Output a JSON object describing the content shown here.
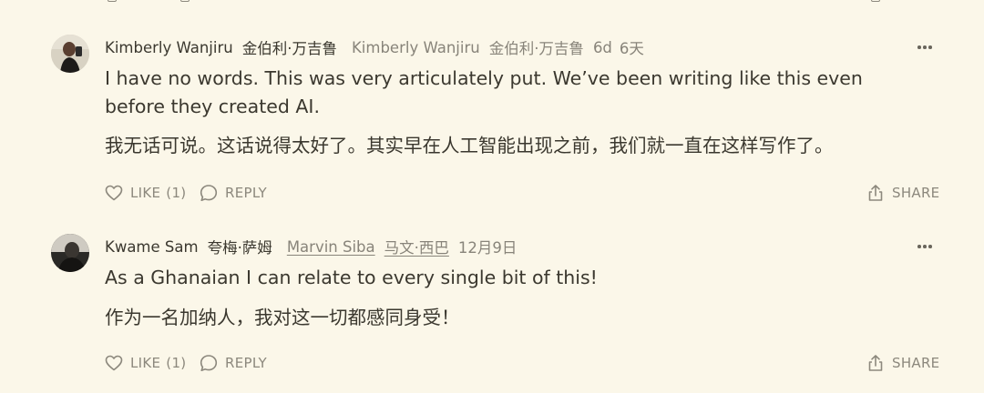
{
  "comments": [
    {
      "author": "Kimberly Wanjiru",
      "author_zh": "金伯利·万吉鲁",
      "reply_to": "Kimberly Wanjiru",
      "reply_to_zh": "金伯利·万吉鲁",
      "time": "6d",
      "time_zh": "6天",
      "text": "I have no words. This was very articulately put. We’ve been writing like this even before they created AI.",
      "text_zh": "我无话可说。这话说得太好了。其实早在人工智能出现之前，我们就一直在这样写作了。",
      "like_label": "LIKE",
      "like_count": "(1)",
      "reply_label": "REPLY",
      "share_label": "SHARE"
    },
    {
      "author": "Kwame Sam",
      "author_zh": "夸梅·萨姆",
      "reply_to": "Marvin Siba",
      "reply_to_zh": "马文·西巴",
      "time": "12月9日",
      "text": "As a Ghanaian I can relate to every single bit of this!",
      "text_zh": "作为一名加纳人，我对这一切都感同身受！",
      "like_label": "LIKE",
      "like_count": "(1)",
      "reply_label": "REPLY",
      "share_label": "SHARE"
    }
  ],
  "icons": {
    "like": "heart-icon",
    "reply": "speech-bubble-icon",
    "share": "share-upload-icon",
    "more": "more-dots-icon"
  },
  "colors": {
    "background": "#fbf7e9",
    "text": "#3b382f",
    "muted": "#88847a"
  }
}
